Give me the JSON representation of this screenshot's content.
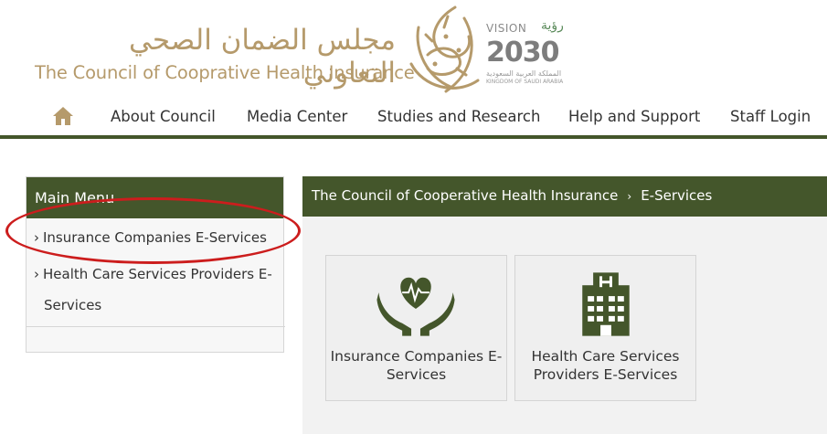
{
  "header": {
    "title_ar": "مجلس الضمان الصحي التعاوني",
    "title_en": "The Council of Cooprative Health Insurance",
    "vision": {
      "top": "VISION",
      "ar": "رؤية",
      "year": "2030",
      "sub_ar": "المملكة العربية السعودية",
      "sub_en": "KINGDOM OF SAUDI ARABIA"
    }
  },
  "nav": {
    "home_icon": "home-icon",
    "items": [
      "About Council",
      "Media Center",
      "Studies and Research",
      "Help and Support",
      "Staff Login"
    ]
  },
  "sidebar": {
    "title": "Main Menu",
    "items": [
      {
        "label": "Insurance Companies E-Services"
      },
      {
        "label": "Health Care Services Providers E-",
        "label_line2": "Services"
      }
    ]
  },
  "breadcrumb": {
    "root": "The Council of Cooperative Health Insurance",
    "separator": "›",
    "current": "E-Services"
  },
  "cards": [
    {
      "icon": "heart-hands-icon",
      "line1": "Insurance Companies E-",
      "line2": "Services"
    },
    {
      "icon": "hospital-building-icon",
      "line1": "Health Care Services",
      "line2": "Providers E-Services"
    }
  ],
  "colors": {
    "brand_green": "#44562b",
    "brand_gold": "#b59a6b",
    "highlight_red": "#cc1d1d"
  }
}
